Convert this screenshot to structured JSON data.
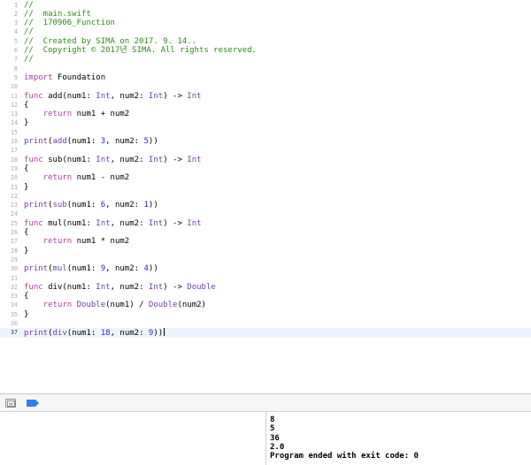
{
  "editor": {
    "current_line": 37,
    "lines": [
      [
        {
          "t": "//",
          "c": "comment"
        }
      ],
      [
        {
          "t": "//  main.swift",
          "c": "comment"
        }
      ],
      [
        {
          "t": "//  170906_Function",
          "c": "comment"
        }
      ],
      [
        {
          "t": "//",
          "c": "comment"
        }
      ],
      [
        {
          "t": "//  Created by SIMA on 2017. 9. 14..",
          "c": "comment"
        }
      ],
      [
        {
          "t": "//  Copyright © 2017년 SIMA. All rights reserved.",
          "c": "comment"
        }
      ],
      [
        {
          "t": "//",
          "c": "comment"
        }
      ],
      [],
      [
        {
          "t": "import",
          "c": "keyword"
        },
        {
          "t": " Foundation",
          "c": "plain"
        }
      ],
      [],
      [
        {
          "t": "func",
          "c": "keyword"
        },
        {
          "t": " add(num1: ",
          "c": "plain"
        },
        {
          "t": "Int",
          "c": "type"
        },
        {
          "t": ", num2: ",
          "c": "plain"
        },
        {
          "t": "Int",
          "c": "type"
        },
        {
          "t": ") -> ",
          "c": "plain"
        },
        {
          "t": "Int",
          "c": "type"
        }
      ],
      [
        {
          "t": "{",
          "c": "plain"
        }
      ],
      [
        {
          "t": "    ",
          "c": "plain"
        },
        {
          "t": "return",
          "c": "keyword"
        },
        {
          "t": " num1 + num2",
          "c": "plain"
        }
      ],
      [
        {
          "t": "}",
          "c": "plain"
        }
      ],
      [],
      [
        {
          "t": "print",
          "c": "type"
        },
        {
          "t": "(",
          "c": "plain"
        },
        {
          "t": "add",
          "c": "type"
        },
        {
          "t": "(num1: ",
          "c": "plain"
        },
        {
          "t": "3",
          "c": "number"
        },
        {
          "t": ", num2: ",
          "c": "plain"
        },
        {
          "t": "5",
          "c": "number"
        },
        {
          "t": "))",
          "c": "plain"
        }
      ],
      [],
      [
        {
          "t": "func",
          "c": "keyword"
        },
        {
          "t": " sub(num1: ",
          "c": "plain"
        },
        {
          "t": "Int",
          "c": "type"
        },
        {
          "t": ", num2: ",
          "c": "plain"
        },
        {
          "t": "Int",
          "c": "type"
        },
        {
          "t": ") -> ",
          "c": "plain"
        },
        {
          "t": "Int",
          "c": "type"
        }
      ],
      [
        {
          "t": "{",
          "c": "plain"
        }
      ],
      [
        {
          "t": "    ",
          "c": "plain"
        },
        {
          "t": "return",
          "c": "keyword"
        },
        {
          "t": " num1 - num2",
          "c": "plain"
        }
      ],
      [
        {
          "t": "}",
          "c": "plain"
        }
      ],
      [],
      [
        {
          "t": "print",
          "c": "type"
        },
        {
          "t": "(",
          "c": "plain"
        },
        {
          "t": "sub",
          "c": "type"
        },
        {
          "t": "(num1: ",
          "c": "plain"
        },
        {
          "t": "6",
          "c": "number"
        },
        {
          "t": ", num2: ",
          "c": "plain"
        },
        {
          "t": "1",
          "c": "number"
        },
        {
          "t": "))",
          "c": "plain"
        }
      ],
      [],
      [
        {
          "t": "func",
          "c": "keyword"
        },
        {
          "t": " mul(num1: ",
          "c": "plain"
        },
        {
          "t": "Int",
          "c": "type"
        },
        {
          "t": ", num2: ",
          "c": "plain"
        },
        {
          "t": "Int",
          "c": "type"
        },
        {
          "t": ") -> ",
          "c": "plain"
        },
        {
          "t": "Int",
          "c": "type"
        }
      ],
      [
        {
          "t": "{",
          "c": "plain"
        }
      ],
      [
        {
          "t": "    ",
          "c": "plain"
        },
        {
          "t": "return",
          "c": "keyword"
        },
        {
          "t": " num1 * num2",
          "c": "plain"
        }
      ],
      [
        {
          "t": "}",
          "c": "plain"
        }
      ],
      [],
      [
        {
          "t": "print",
          "c": "type"
        },
        {
          "t": "(",
          "c": "plain"
        },
        {
          "t": "mul",
          "c": "type"
        },
        {
          "t": "(num1: ",
          "c": "plain"
        },
        {
          "t": "9",
          "c": "number"
        },
        {
          "t": ", num2: ",
          "c": "plain"
        },
        {
          "t": "4",
          "c": "number"
        },
        {
          "t": "))",
          "c": "plain"
        }
      ],
      [],
      [
        {
          "t": "func",
          "c": "keyword"
        },
        {
          "t": " div(num1: ",
          "c": "plain"
        },
        {
          "t": "Int",
          "c": "type"
        },
        {
          "t": ", num2: ",
          "c": "plain"
        },
        {
          "t": "Int",
          "c": "type"
        },
        {
          "t": ") -> ",
          "c": "plain"
        },
        {
          "t": "Double",
          "c": "type"
        }
      ],
      [
        {
          "t": "{",
          "c": "plain"
        }
      ],
      [
        {
          "t": "    ",
          "c": "plain"
        },
        {
          "t": "return",
          "c": "keyword"
        },
        {
          "t": " ",
          "c": "plain"
        },
        {
          "t": "Double",
          "c": "type"
        },
        {
          "t": "(num1) / ",
          "c": "plain"
        },
        {
          "t": "Double",
          "c": "type"
        },
        {
          "t": "(num2)",
          "c": "plain"
        }
      ],
      [
        {
          "t": "}",
          "c": "plain"
        }
      ],
      [],
      [
        {
          "t": "print",
          "c": "type"
        },
        {
          "t": "(",
          "c": "plain"
        },
        {
          "t": "div",
          "c": "type"
        },
        {
          "t": "(num1: ",
          "c": "plain"
        },
        {
          "t": "18",
          "c": "number"
        },
        {
          "t": ", num2: ",
          "c": "plain"
        },
        {
          "t": "9",
          "c": "number"
        },
        {
          "t": "))",
          "c": "plain"
        }
      ]
    ]
  },
  "debug_bar": {
    "hide_button_icon": "hide-debug-area-icon",
    "breakpoints_icon": "breakpoint-toggle-icon",
    "breakpoint_color": "#2f7cf6"
  },
  "console": {
    "lines": [
      "8",
      "5",
      "36",
      "2.0",
      "Program ended with exit code: 0"
    ]
  },
  "colors": {
    "comment": "#2e8a17",
    "keyword": "#ad3da4",
    "type": "#703daa",
    "number": "#272ad8",
    "current_line_bg": "#ecf5ff"
  }
}
